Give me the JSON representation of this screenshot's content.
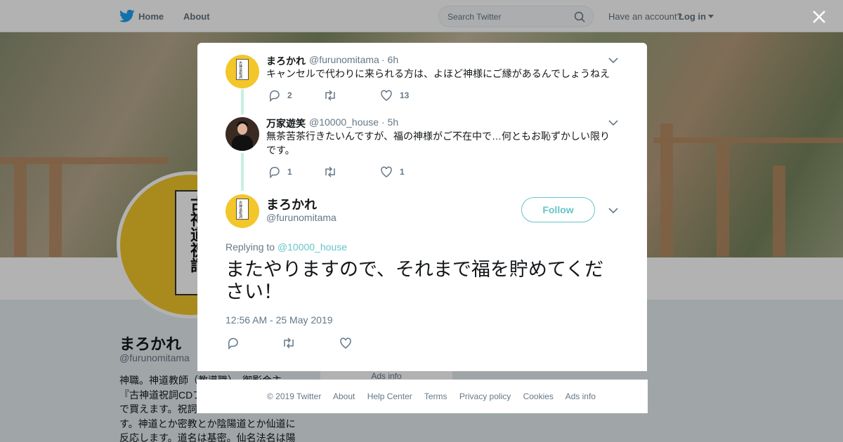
{
  "nav": {
    "home": "Home",
    "about": "About",
    "search_placeholder": "Search Twitter",
    "have_account": "Have an account?",
    "login": "Log in"
  },
  "background_profile": {
    "name": "まろかれ",
    "handle": "@furunomitama",
    "bio": "神職。神道教師（教導職）。御影会主\n『古神道祝詞CDブ\nで買えます。祝詞\nす。神道とか密教とか陰陽道とか仙道に\n反応します。道名は基密。仙名法名は陽",
    "ads_info": "Ads info",
    "avatar_text": "古神道祝詞",
    "avatar_sub": "CDブック"
  },
  "thread": [
    {
      "name": "まろかれ",
      "handle": "@furunomitama",
      "time": "· 6h",
      "text": "キャンセルで代わりに来られる方は、よほど神様にご縁があるんでしょうねえ",
      "replies": "2",
      "retweets": "",
      "likes": "13",
      "avatar": "yellow-seal"
    },
    {
      "name": "万家遊笑",
      "handle": "@10000_house",
      "time": "· 5h",
      "text": "無茶苦茶行きたいんですが、福の神様がご不在中で…何ともお恥ずかしい限りです。",
      "replies": "1",
      "retweets": "",
      "likes": "1",
      "avatar": "person-dark"
    }
  ],
  "main_tweet": {
    "name": "まろかれ",
    "handle": "@furunomitama",
    "follow_label": "Follow",
    "replying_prefix": "Replying to",
    "replying_to": "@10000_house",
    "text": "またやりますので、それまで福を貯めてください！",
    "timestamp": "12:56 AM - 25 May 2019"
  },
  "footer": {
    "links": [
      "© 2019 Twitter",
      "About",
      "Help Center",
      "Terms",
      "Privacy policy",
      "Cookies",
      "Ads info"
    ]
  },
  "colors": {
    "accent": "#66c5c9",
    "thread_line": "#c8efe4",
    "twitter_blue": "#1da1f2",
    "muted": "#657786"
  }
}
